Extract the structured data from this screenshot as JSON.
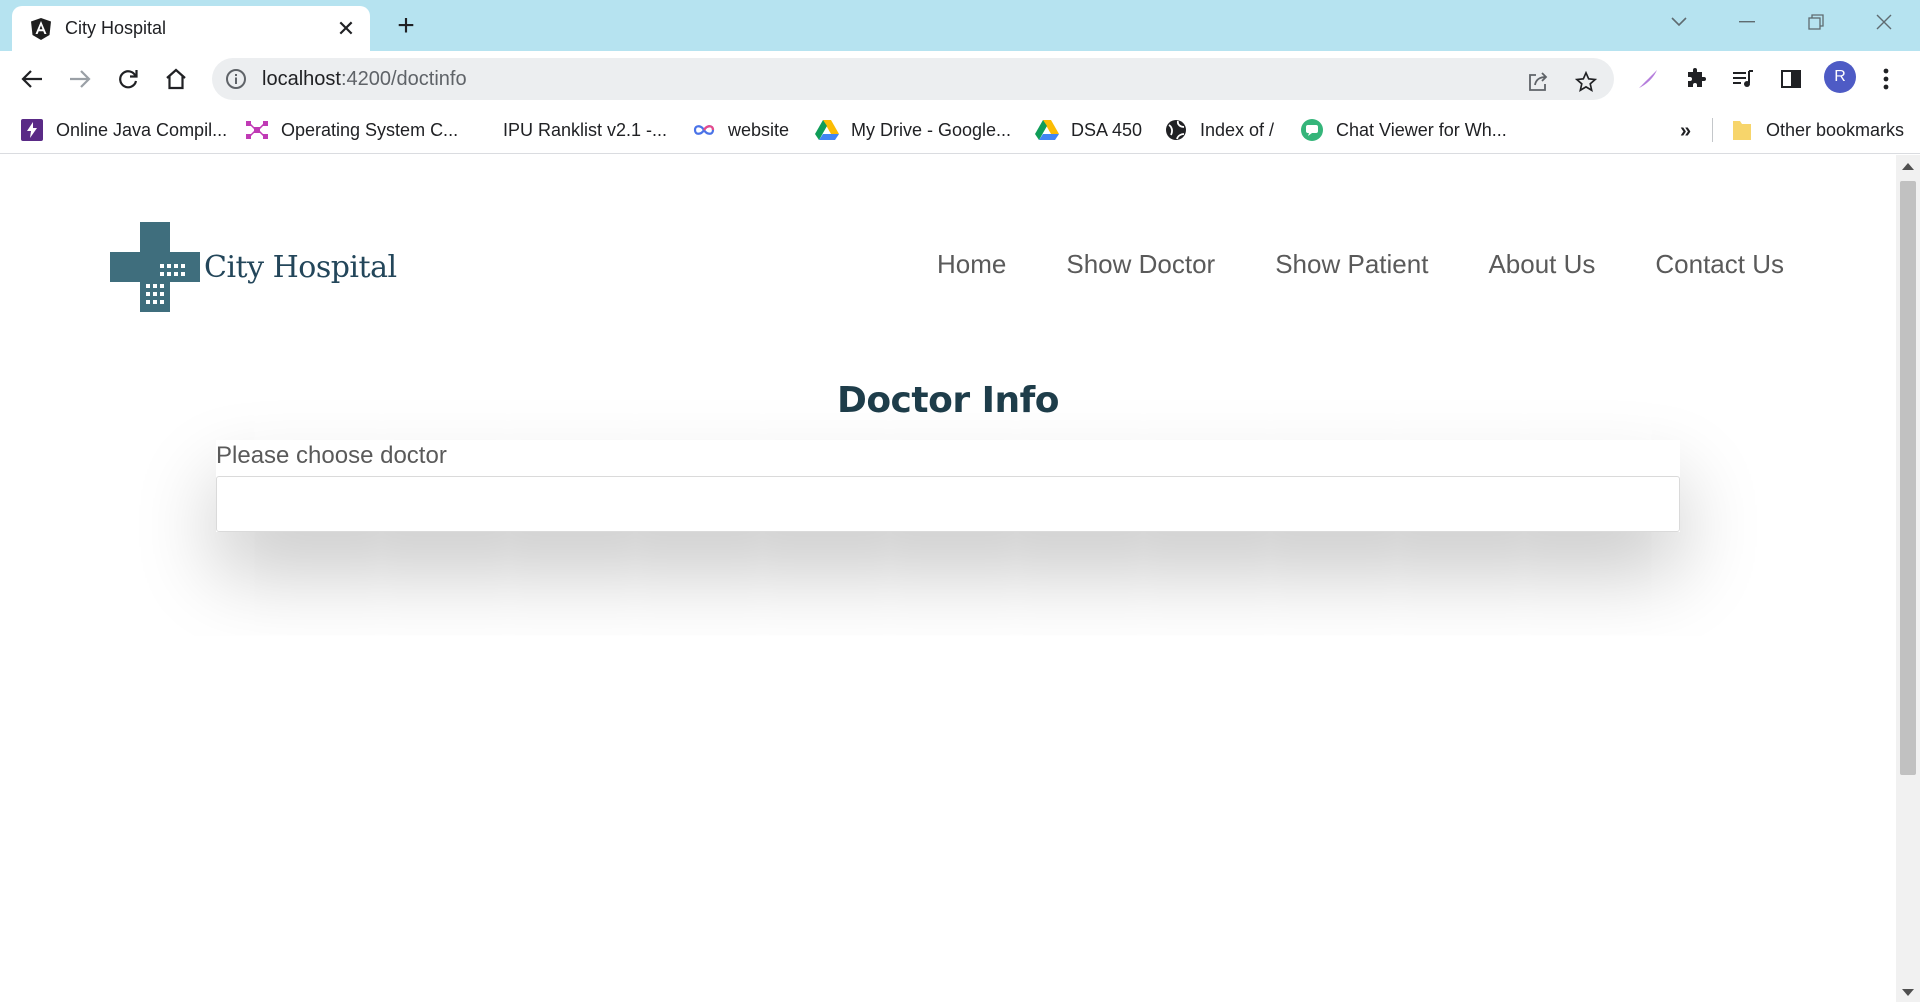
{
  "browser": {
    "tab_title": "City Hospital",
    "url_host": "localhost",
    "url_path": ":4200/doctinfo",
    "avatar_letter": "R",
    "bookmarks": [
      {
        "label": "Online Java Compil...",
        "icon": "bolt-icon"
      },
      {
        "label": "Operating System C...",
        "icon": "network-icon"
      },
      {
        "label": "IPU Ranklist v2.1 -...",
        "icon": "blank-icon"
      },
      {
        "label": "website",
        "icon": "infinity-icon"
      },
      {
        "label": "My Drive - Google...",
        "icon": "drive-icon"
      },
      {
        "label": "DSA 450",
        "icon": "drive-icon"
      },
      {
        "label": "Index of /",
        "icon": "globe-icon"
      },
      {
        "label": "Chat Viewer for Wh...",
        "icon": "chat-icon"
      }
    ],
    "more_bookmarks": "»",
    "other_bookmarks": "Other bookmarks"
  },
  "site": {
    "logo_text": "City Hospital",
    "nav": [
      "Home",
      "Show Doctor",
      "Show Patient",
      "About Us",
      "Contact Us"
    ]
  },
  "main": {
    "title": "Doctor Info",
    "select_label": "Please choose doctor",
    "select_value": ""
  },
  "colors": {
    "tabstrip": "#b6e3f0",
    "logo_teal": "#3f6e7d",
    "title": "#1e3d4a",
    "nav_text": "#5a5a5a"
  }
}
